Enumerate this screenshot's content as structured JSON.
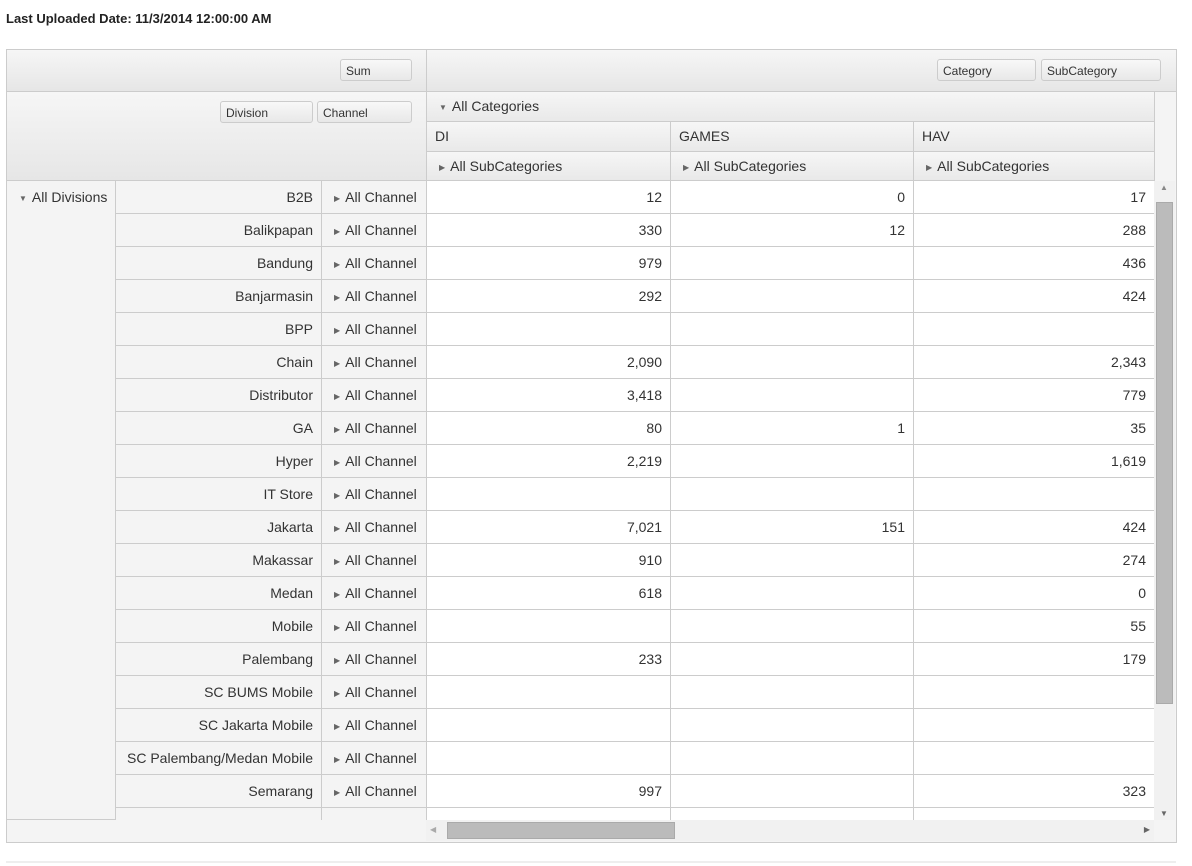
{
  "header": {
    "last_uploaded": "Last Uploaded Date: 11/3/2014 12:00:00 AM"
  },
  "pivot": {
    "data_field": "Sum",
    "column_fields": [
      "Category",
      "SubCategory"
    ],
    "row_fields": [
      "Division",
      "Channel"
    ],
    "all_categories": "All Categories",
    "categories": [
      "DI",
      "GAMES",
      "HAV"
    ],
    "all_subcategories": "All SubCategories",
    "all_divisions": "All Divisions",
    "all_channel": "All Channel",
    "rows": [
      {
        "name": "B2B",
        "values": [
          "12",
          "0",
          "17"
        ]
      },
      {
        "name": "Balikpapan",
        "values": [
          "330",
          "12",
          "288"
        ]
      },
      {
        "name": "Bandung",
        "values": [
          "979",
          "",
          "436"
        ]
      },
      {
        "name": "Banjarmasin",
        "values": [
          "292",
          "",
          "424"
        ]
      },
      {
        "name": "BPP",
        "values": [
          "",
          "",
          ""
        ]
      },
      {
        "name": "Chain",
        "values": [
          "2,090",
          "",
          "2,343"
        ]
      },
      {
        "name": "Distributor",
        "values": [
          "3,418",
          "",
          "779"
        ]
      },
      {
        "name": "GA",
        "values": [
          "80",
          "1",
          "35"
        ]
      },
      {
        "name": "Hyper",
        "values": [
          "2,219",
          "",
          "1,619"
        ]
      },
      {
        "name": "IT Store",
        "values": [
          "",
          "",
          ""
        ]
      },
      {
        "name": "Jakarta",
        "values": [
          "7,021",
          "151",
          "424"
        ]
      },
      {
        "name": "Makassar",
        "values": [
          "910",
          "",
          "274"
        ]
      },
      {
        "name": "Medan",
        "values": [
          "618",
          "",
          "0"
        ]
      },
      {
        "name": "Mobile",
        "values": [
          "",
          "",
          "55"
        ]
      },
      {
        "name": "Palembang",
        "values": [
          "233",
          "",
          "179"
        ]
      },
      {
        "name": "SC BUMS Mobile",
        "values": [
          "",
          "",
          ""
        ]
      },
      {
        "name": "SC Jakarta Mobile",
        "values": [
          "",
          "",
          ""
        ]
      },
      {
        "name": "SC Palembang/Medan Mobile",
        "values": [
          "",
          "",
          ""
        ]
      },
      {
        "name": "Semarang",
        "values": [
          "997",
          "",
          "323"
        ]
      }
    ]
  },
  "icons": {
    "expanded": "triangle-down",
    "collapsed": "triangle-right"
  }
}
